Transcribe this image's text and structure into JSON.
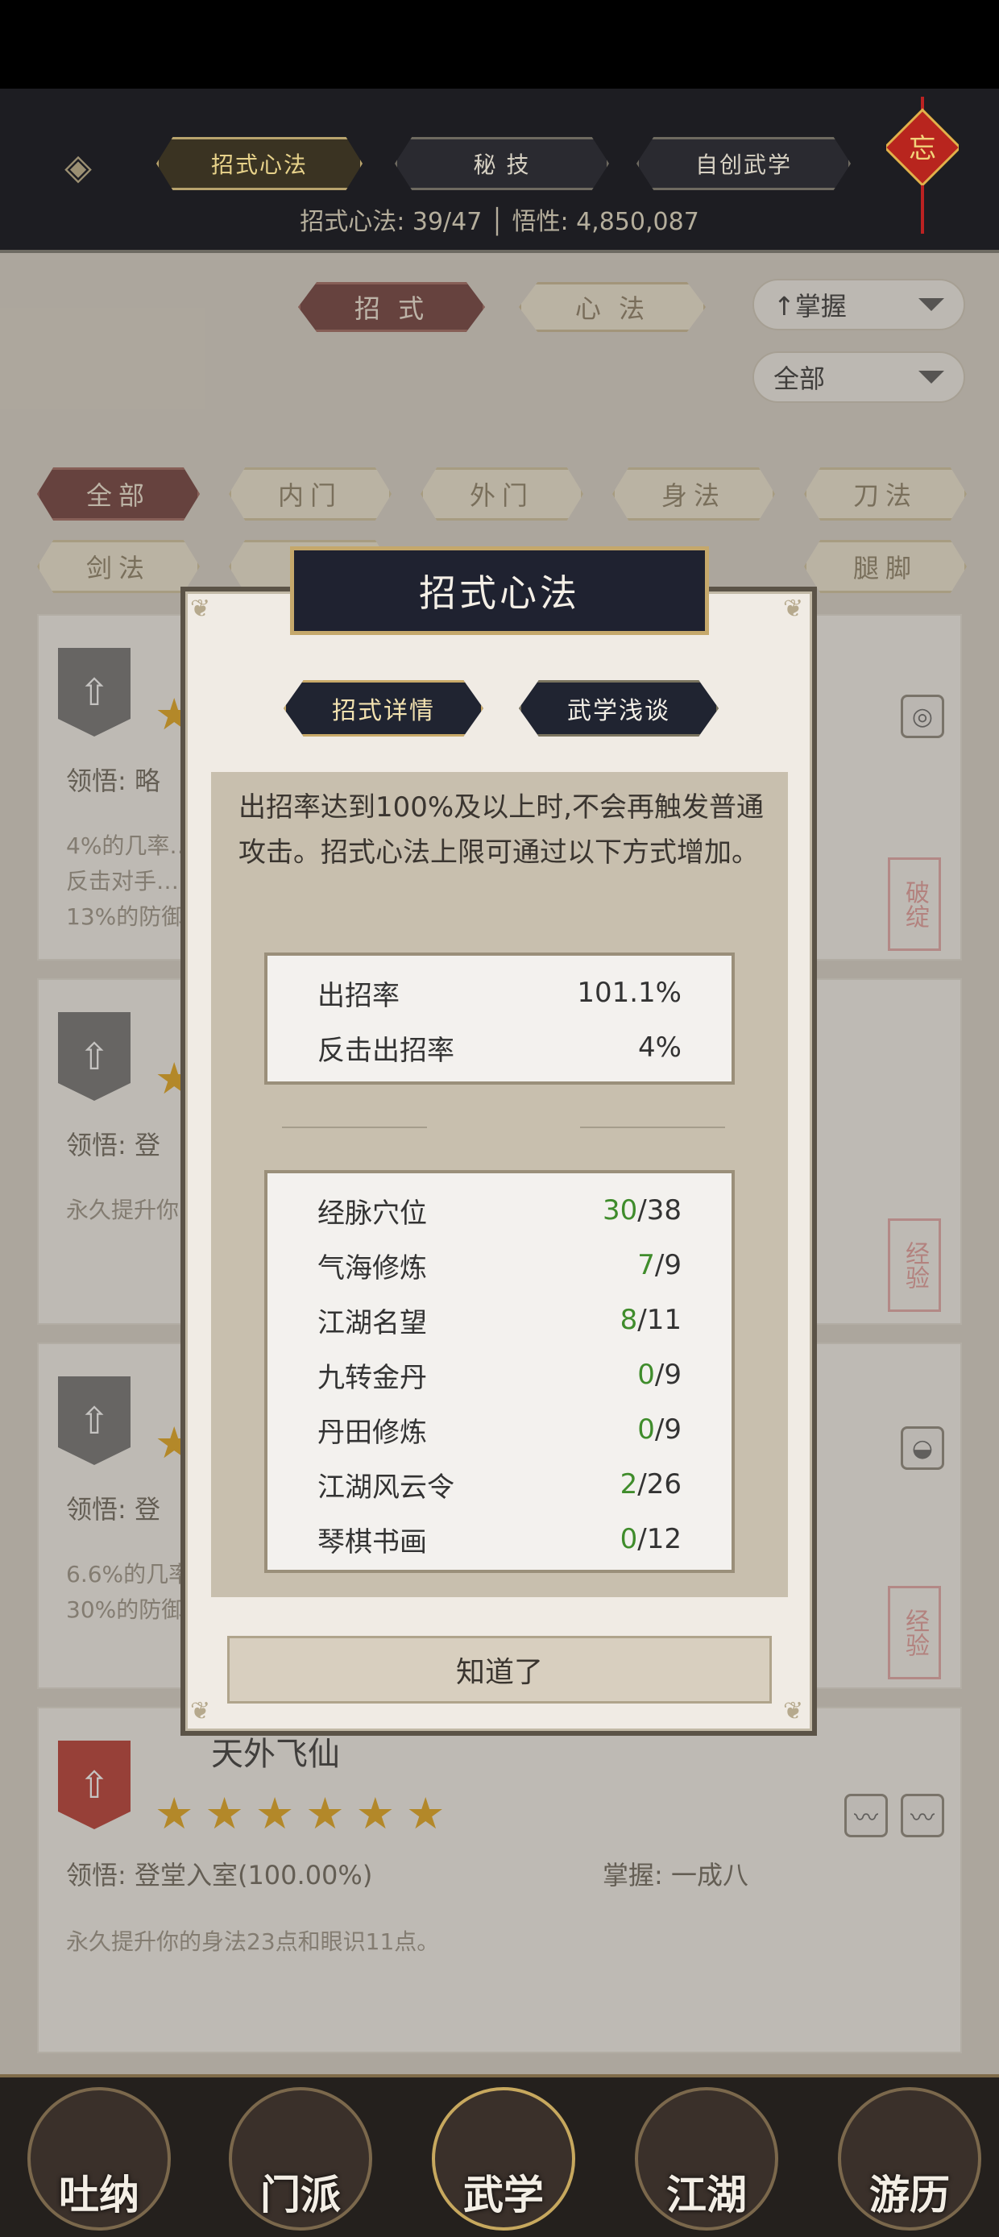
{
  "header": {
    "tabs": [
      "招式心法",
      "秘 技",
      "自创武学"
    ],
    "active_tab": 0,
    "stats_text": "招式心法: 39/47  │  悟性: 4,850,087",
    "knot_char": "忘"
  },
  "subtabs": [
    "招 式",
    "心 法"
  ],
  "dropdowns": {
    "sort": "↑掌握",
    "filter": "全部"
  },
  "filters_row1": [
    "全部",
    "内门",
    "外门",
    "身法",
    "刀法"
  ],
  "filters_row2": [
    "剑法",
    "",
    "",
    "",
    "腿脚"
  ],
  "cards": [
    {
      "understand_label": "领悟: 略",
      "desc": "4%的几率…\n反击对手…\n13%的防御…",
      "stamp": "破绽"
    },
    {
      "understand_label": "领悟: 登",
      "desc": "永久提升你…",
      "stamp": "经验"
    },
    {
      "understand_label": "领悟: 登",
      "desc": "6.6%的几率…\n30%的防御…",
      "stamp": "经验"
    },
    {
      "name": "天外飞仙",
      "understand_label": "领悟: 登堂入室(100.00%)",
      "master_label": "掌握: 一成八",
      "desc": "永久提升你的身法23点和眼识11点。"
    }
  ],
  "nav": [
    "吐纳",
    "门派",
    "武学",
    "江湖",
    "游历"
  ],
  "modal": {
    "title": "招式心法",
    "tabs": [
      "招式详情",
      "武学浅谈"
    ],
    "desc": "出招率达到100%及以上时,不会再触发普通攻击。招式心法上限可通过以下方式增加。",
    "rates": [
      {
        "label": "出招率",
        "value": "101.1%"
      },
      {
        "label": "反击出招率",
        "value": "4%"
      }
    ],
    "sources": [
      {
        "label": "经脉穴位",
        "have": "30",
        "max": "/38"
      },
      {
        "label": "气海修炼",
        "have": "7",
        "max": "/9"
      },
      {
        "label": "江湖名望",
        "have": "8",
        "max": "/11"
      },
      {
        "label": "九转金丹",
        "have": "0",
        "max": "/9"
      },
      {
        "label": "丹田修炼",
        "have": "0",
        "max": "/9"
      },
      {
        "label": "江湖风云令",
        "have": "2",
        "max": "/26"
      },
      {
        "label": "琴棋书画",
        "have": "0",
        "max": "/12"
      }
    ],
    "ok": "知道了"
  }
}
